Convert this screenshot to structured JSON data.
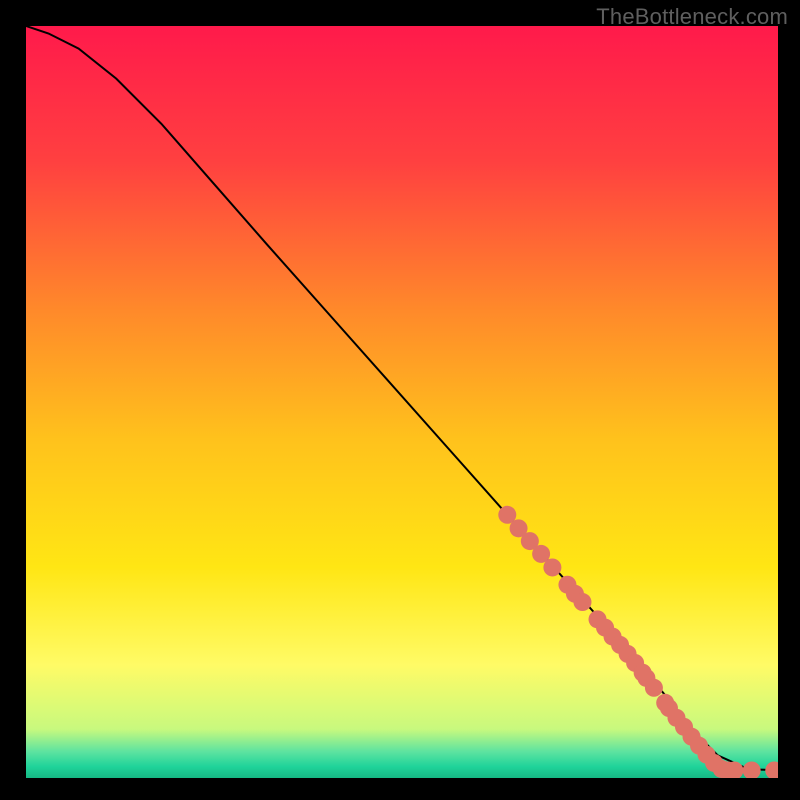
{
  "watermark": "TheBottleneck.com",
  "chart_data": {
    "type": "line",
    "title": "",
    "xlabel": "",
    "ylabel": "",
    "xlim": [
      0,
      100
    ],
    "ylim": [
      0,
      100
    ],
    "grid": false,
    "axes_visible": false,
    "background_gradient": {
      "stops": [
        {
          "offset": 0.0,
          "color": "#ff1a4b"
        },
        {
          "offset": 0.18,
          "color": "#ff4040"
        },
        {
          "offset": 0.38,
          "color": "#ff8a2a"
        },
        {
          "offset": 0.55,
          "color": "#ffc21c"
        },
        {
          "offset": 0.72,
          "color": "#ffe614"
        },
        {
          "offset": 0.85,
          "color": "#fffb66"
        },
        {
          "offset": 0.935,
          "color": "#c8f97e"
        },
        {
          "offset": 0.965,
          "color": "#5de3a0"
        },
        {
          "offset": 0.985,
          "color": "#1fd39a"
        },
        {
          "offset": 1.0,
          "color": "#16b884"
        }
      ]
    },
    "series": [
      {
        "name": "curve",
        "stroke": "#000000",
        "x": [
          0,
          3,
          7,
          12,
          18,
          25,
          32,
          40,
          48,
          56,
          64,
          72,
          80,
          85,
          88,
          92,
          96,
          100
        ],
        "y": [
          100,
          99,
          97,
          93,
          87,
          79,
          71,
          62,
          53,
          44,
          35,
          26,
          17,
          11,
          7,
          3,
          1.2,
          1.0
        ]
      }
    ],
    "overlay_points": {
      "name": "highlighted-segment",
      "color": "#e07366",
      "radius_px": 9,
      "points": [
        {
          "x": 64.0,
          "y": 35.0
        },
        {
          "x": 65.5,
          "y": 33.2
        },
        {
          "x": 67.0,
          "y": 31.5
        },
        {
          "x": 68.5,
          "y": 29.8
        },
        {
          "x": 70.0,
          "y": 28.0
        },
        {
          "x": 72.0,
          "y": 25.7
        },
        {
          "x": 73.0,
          "y": 24.5
        },
        {
          "x": 74.0,
          "y": 23.4
        },
        {
          "x": 76.0,
          "y": 21.1
        },
        {
          "x": 77.0,
          "y": 20.0
        },
        {
          "x": 78.0,
          "y": 18.8
        },
        {
          "x": 79.0,
          "y": 17.7
        },
        {
          "x": 80.0,
          "y": 16.5
        },
        {
          "x": 81.0,
          "y": 15.3
        },
        {
          "x": 82.0,
          "y": 14.0
        },
        {
          "x": 82.5,
          "y": 13.3
        },
        {
          "x": 83.5,
          "y": 12.0
        },
        {
          "x": 85.0,
          "y": 10.0
        },
        {
          "x": 85.5,
          "y": 9.3
        },
        {
          "x": 86.5,
          "y": 8.0
        },
        {
          "x": 87.5,
          "y": 6.8
        },
        {
          "x": 88.5,
          "y": 5.5
        },
        {
          "x": 89.5,
          "y": 4.3
        },
        {
          "x": 90.5,
          "y": 3.1
        },
        {
          "x": 91.5,
          "y": 2.0
        },
        {
          "x": 92.5,
          "y": 1.2
        },
        {
          "x": 93.3,
          "y": 1.0
        },
        {
          "x": 94.2,
          "y": 1.0
        },
        {
          "x": 96.5,
          "y": 1.0
        },
        {
          "x": 99.5,
          "y": 1.0
        },
        {
          "x": 100.5,
          "y": 1.0
        }
      ]
    }
  }
}
